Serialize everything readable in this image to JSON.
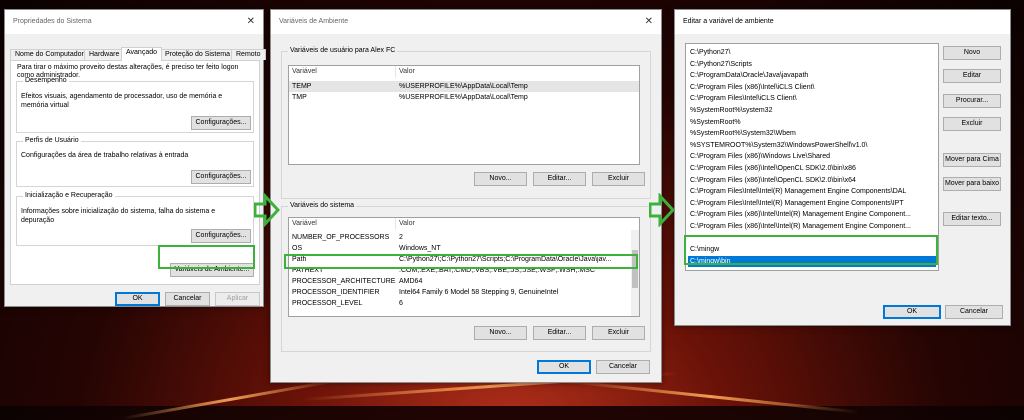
{
  "accent": "#0078d7",
  "highlight_color": "#3cb23c",
  "sysprops": {
    "title": "Propriedades do Sistema",
    "tabs": [
      "Nome do Computador",
      "Hardware",
      "Avançado",
      "Proteção do Sistema",
      "Remoto"
    ],
    "admin_note": "Para tirar o máximo proveito destas alterações, é preciso ter feito logon como administrador.",
    "perf_label": "Desempenho",
    "perf_desc": "Efeitos visuais, agendamento de processador, uso de memória e memória virtual",
    "profiles_label": "Perfis de Usuário",
    "profiles_desc": "Configurações da área de trabalho relativas à entrada",
    "startup_label": "Inicialização e Recuperação",
    "startup_desc": "Informações sobre inicialização do sistema, falha do sistema e depuração",
    "settings_btn": "Configurações...",
    "env_btn": "Variáveis de Ambiente...",
    "ok": "OK",
    "cancel": "Cancelar",
    "apply": "Aplicar"
  },
  "envvars": {
    "title": "Variáveis de Ambiente",
    "user_label": "Variáveis de usuário para Alex FC",
    "col_var": "Variável",
    "col_val": "Valor",
    "user_rows": [
      {
        "var": "TEMP",
        "val": "%USERPROFILE%\\AppData\\Local\\Temp"
      },
      {
        "var": "TMP",
        "val": "%USERPROFILE%\\AppData\\Local\\Temp"
      }
    ],
    "sys_label": "Variáveis do sistema",
    "sys_rows": [
      {
        "var": "NUMBER_OF_PROCESSORS",
        "val": "2"
      },
      {
        "var": "OS",
        "val": "Windows_NT"
      },
      {
        "var": "Path",
        "val": "C:\\Python27\\;C:\\Python27\\Scripts;C:\\ProgramData\\Oracle\\Java\\jav..."
      },
      {
        "var": "PATHEXT",
        "val": ".COM;.EXE;.BAT;.CMD;.VBS;.VBE;.JS;.JSE;.WSF;.WSH;.MSC"
      },
      {
        "var": "PROCESSOR_ARCHITECTURE",
        "val": "AMD64"
      },
      {
        "var": "PROCESSOR_IDENTIFIER",
        "val": "Intel64 Family 6 Model 58 Stepping 9, GenuineIntel"
      },
      {
        "var": "PROCESSOR_LEVEL",
        "val": "6"
      }
    ],
    "new_btn": "Novo...",
    "edit_btn": "Editar...",
    "delete_btn": "Excluir",
    "ok": "OK",
    "cancel": "Cancelar"
  },
  "editvar": {
    "title": "Editar a variável de ambiente",
    "items": [
      "C:\\Python27\\",
      "C:\\Python27\\Scripts",
      "C:\\ProgramData\\Oracle\\Java\\javapath",
      "C:\\Program Files (x86)\\Intel\\iCLS Client\\",
      "C:\\Program Files\\Intel\\iCLS Client\\",
      "%SystemRoot%\\system32",
      "%SystemRoot%",
      "%SystemRoot%\\System32\\Wbem",
      "%SYSTEMROOT%\\System32\\WindowsPowerShell\\v1.0\\",
      "C:\\Program Files (x86)\\Windows Live\\Shared",
      "C:\\Program Files (x86)\\Intel\\OpenCL SDK\\2.0\\bin\\x86",
      "C:\\Program Files (x86)\\Intel\\OpenCL SDK\\2.0\\bin\\x64",
      "C:\\Program Files\\Intel\\Intel(R) Management Engine Components\\DAL",
      "C:\\Program Files\\Intel\\Intel(R) Management Engine Components\\IPT",
      "C:\\Program Files (x86)\\Intel\\Intel(R) Management Engine Component...",
      "C:\\Program Files (x86)\\Intel\\Intel(R) Management Engine Component...",
      "C:\\mingw",
      "C:\\mingw\\bin"
    ],
    "buttons": [
      "Novo",
      "Editar",
      "Procurar...",
      "Excluir",
      "Mover para Cima",
      "Mover para baixo",
      "Editar texto..."
    ],
    "ok": "OK",
    "cancel": "Cancelar"
  }
}
